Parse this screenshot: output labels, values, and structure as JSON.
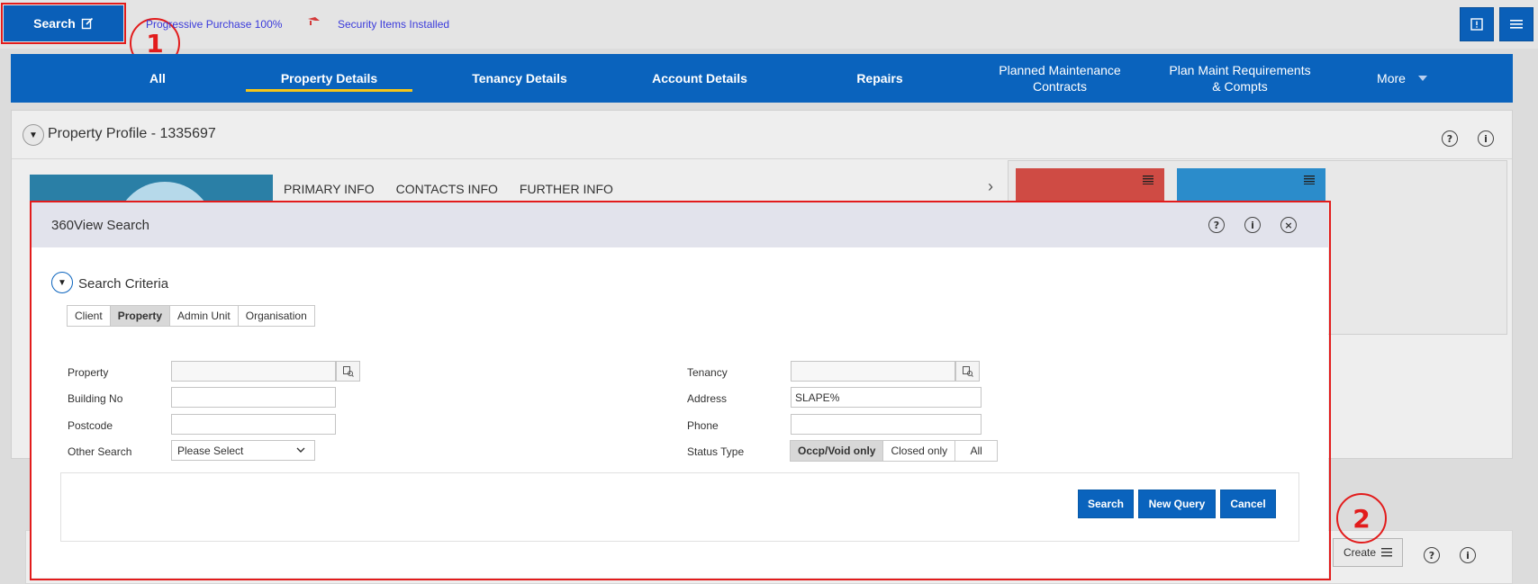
{
  "topbar": {
    "search_label": "Search",
    "link1": "Progressive Purchase 100%",
    "link2": "Security Items Installed",
    "callout1": "1",
    "callout2": "2"
  },
  "nav": {
    "items": [
      "All",
      "Property Details",
      "Tenancy Details",
      "Account Details",
      "Repairs"
    ],
    "planned": [
      "Planned Maintenance",
      "Contracts"
    ],
    "plan_req": [
      "Plan Maint Requirements",
      "& Compts"
    ],
    "more": "More"
  },
  "profile": {
    "title": "Property Profile - 1335697",
    "tabs": [
      "PRIMARY INFO",
      "CONTACTS INFO",
      "FURTHER INFO"
    ]
  },
  "lower": {
    "create_label": "Create"
  },
  "dialog": {
    "title": "360View Search",
    "criteria_title": "Search Criteria",
    "tabs": [
      "Client",
      "Property",
      "Admin Unit",
      "Organisation"
    ],
    "selected_tab": "Property",
    "fields": {
      "property_label": "Property",
      "building_label": "Building No",
      "postcode_label": "Postcode",
      "other_label": "Other Search",
      "other_value": "Please Select",
      "tenancy_label": "Tenancy",
      "address_label": "Address",
      "address_value": "SLAPE%",
      "phone_label": "Phone",
      "status_label": "Status Type"
    },
    "status_options": [
      "Occp/Void only",
      "Closed only",
      "All"
    ],
    "status_selected": "Occp/Void only",
    "buttons": {
      "search": "Search",
      "new_query": "New Query",
      "cancel": "Cancel"
    }
  },
  "colors": {
    "primary": "#0a63bd",
    "highlight": "#e21c1c",
    "active_tab": "#f5c518",
    "card_red": "#cf4b44",
    "card_blue": "#2b8ccb"
  }
}
